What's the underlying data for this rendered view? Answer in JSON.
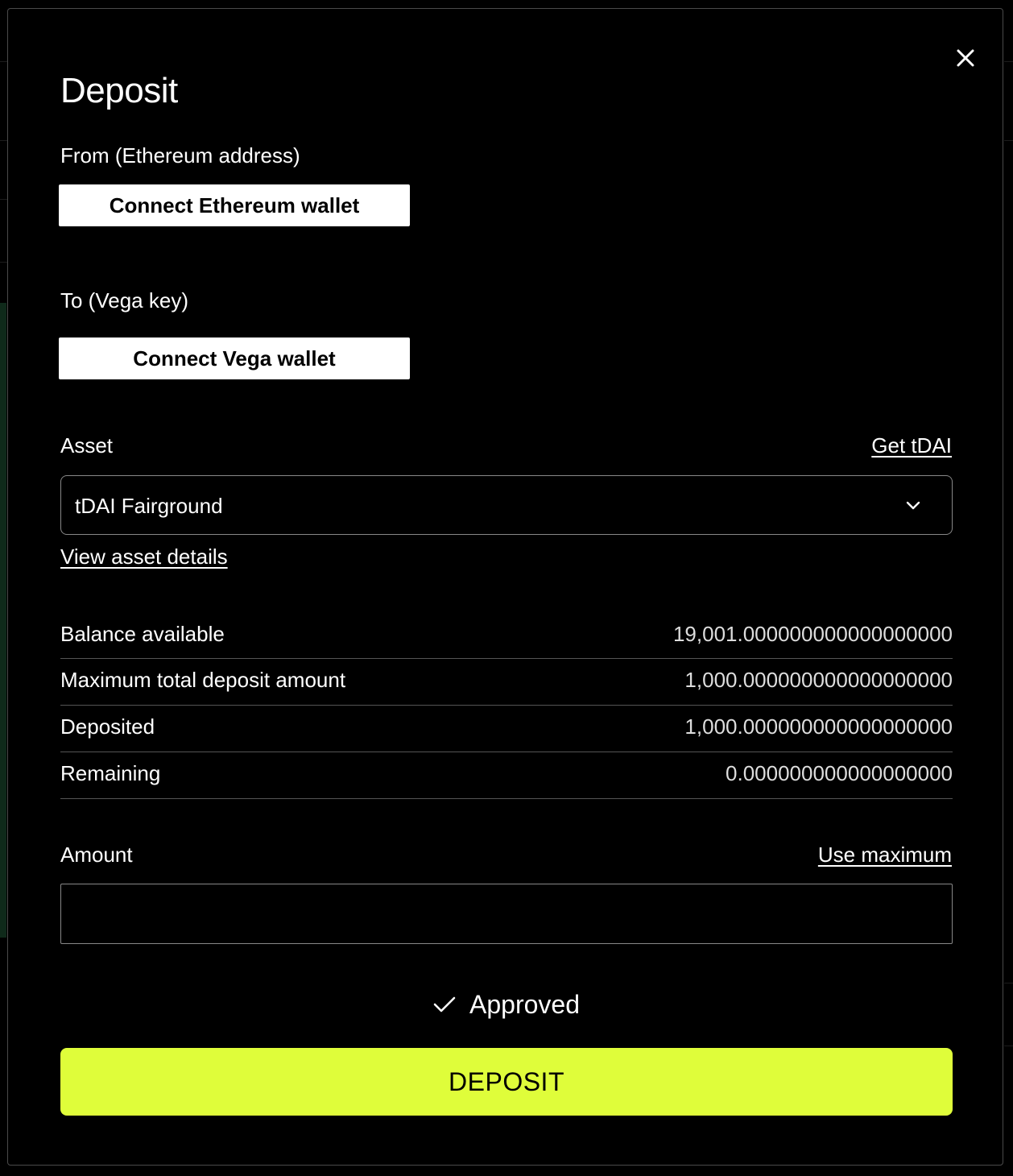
{
  "dialog": {
    "title": "Deposit",
    "close_icon": "close-icon"
  },
  "from": {
    "label": "From (Ethereum address)",
    "button_label": "Connect Ethereum wallet"
  },
  "to": {
    "label": "To (Vega key)",
    "button_label": "Connect Vega wallet"
  },
  "asset": {
    "label": "Asset",
    "get_link": "Get tDAI",
    "selected": "tDAI Fairground",
    "chevron_icon": "chevron-down-icon",
    "details_link": "View asset details"
  },
  "info": {
    "rows": [
      {
        "label": "Balance available",
        "value": "19,001.000000000000000000"
      },
      {
        "label": "Maximum total deposit amount",
        "value": "1,000.000000000000000000"
      },
      {
        "label": "Deposited",
        "value": "1,000.000000000000000000"
      },
      {
        "label": "Remaining",
        "value": "0.000000000000000000"
      }
    ]
  },
  "amount": {
    "label": "Amount",
    "use_max_link": "Use maximum",
    "value": "",
    "placeholder": ""
  },
  "approval": {
    "icon": "check-icon",
    "text": "Approved"
  },
  "submit": {
    "label": "DEPOSIT"
  },
  "colors": {
    "background": "#000000",
    "accent": "#dffd3a",
    "border": "#888888",
    "divider": "#555555",
    "text": "#ffffff"
  }
}
